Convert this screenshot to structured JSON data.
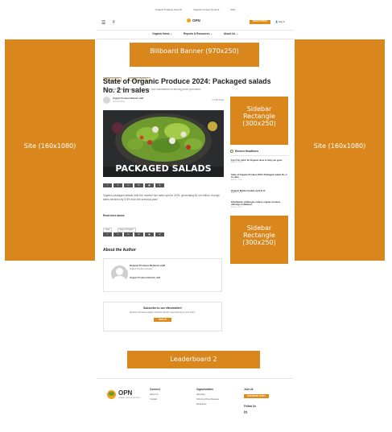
{
  "topbar": {
    "links": [
      "Organic Produce Summit",
      "Organic Grower Summit",
      "FAQ"
    ]
  },
  "header": {
    "logo_text": "OPN",
    "signup_label": "SIGN UP TODAY",
    "signin_label": "Sign In"
  },
  "nav": {
    "items": [
      "Organic News ⌄",
      "Reports & Resources ⌄",
      "About Us ⌄"
    ]
  },
  "ads": {
    "billboard": "Billboard Banner (970x250)",
    "site_left": "Site (160x1080)",
    "site_right": "Site (160x1080)",
    "rect_1": "Sidebar Rectangle (300x250)",
    "rect_2": "Sidebar Rectangle (300x250)",
    "leaderboard": "Leaderboard 2"
  },
  "article": {
    "tags": [
      "ORGANIC DATA",
      "ORGANIC MARKETS"
    ],
    "title": "State of Organic Produce 2024: Packaged salads No. 2 in sales",
    "subtitle": "Packaged salads dropped in volume, but maintained a strong price premium.",
    "author": "Organic Produce Network staff",
    "date": "April 15, 2024",
    "read_time": "5 Min Read",
    "hero_caption": "PACKAGED SALADS",
    "share": [
      "f",
      "𝕏",
      "in",
      "✉",
      "▣",
      "⎘"
    ],
    "body": "Organic packaged salads held the number two sales spot in 2024, generating $1.xxx billion, though sales declined by 5.5% from the previous year.",
    "read_more_label": "Read more about:",
    "read_more_tags": [
      "Data",
      "State of Organic"
    ]
  },
  "about": {
    "heading": "About the Author",
    "name": "Organic Produce Network staff",
    "org": "Organic Produce Network",
    "bio": "Organic Produce Network staff"
  },
  "newsletter": {
    "title": "Subscribe to our eNewsletter!",
    "text": "Receive the latest organic produce industry news directly to your inbox.",
    "button": "SIGN UP"
  },
  "sidebar": {
    "heading": "Recent Headlines",
    "items": [
      {
        "title": "Top 5 for April: An Organic dose to help you grow",
        "date": "APR 15, 2024"
      },
      {
        "title": "State of Organic Produce 2024: Packaged salads No. 2 in sales",
        "date": "APR 15, 2024"
      },
      {
        "title": "Organic Market Update April 8-14",
        "date": "APR 15, 2024"
      },
      {
        "title": "Distribution challenges reduce organic produce offerings in Midwest",
        "date": "APR 15, 2024"
      }
    ]
  },
  "footer": {
    "logo_text": "OPN",
    "logo_sub": "ORGANIC PRODUCE NETWORK",
    "connect_heading": "Connect",
    "connect_links": [
      "About Us",
      "Contact"
    ],
    "opp_heading": "Opportunities",
    "opp_links": [
      "Advertise",
      "Submit a Press Release",
      "Resources"
    ],
    "join_heading": "Join Us",
    "join_button": "SUBSCRIBE TODAY",
    "follow_heading": "Follow Us",
    "follow_icon": "in"
  }
}
